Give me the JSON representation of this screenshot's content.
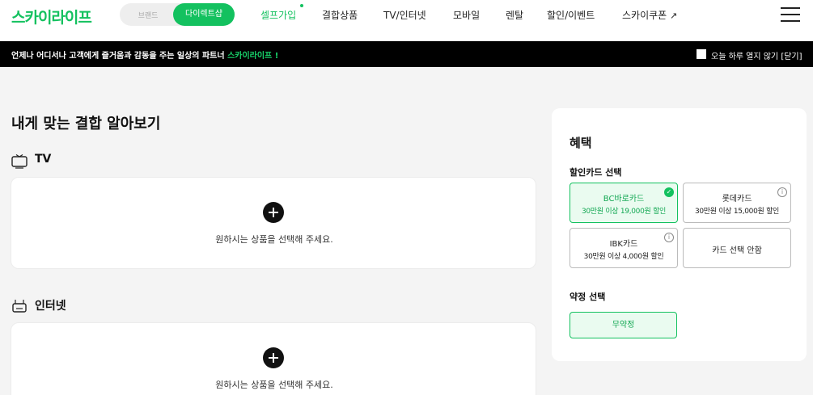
{
  "header": {
    "logo": "스카이라이프",
    "toggle": {
      "brand": "브랜드",
      "direct": "다이렉트샵"
    },
    "nav": [
      "셀프가입",
      "결합상품",
      "TV/인터넷",
      "모바일",
      "렌탈",
      "할인/이벤트",
      "스카이쿠폰"
    ],
    "nav_external_arrow": "↗",
    "menu_icon": "hamburger-menu-icon"
  },
  "notice": {
    "text": "언제나 어디서나 고객에게 즐거움과 감동을 주는 일상의 파트너 ",
    "highlight": "스카이라이프 !",
    "hide_today": "오늘 하루 열지 않기 [닫기]"
  },
  "main": {
    "title": "내게 맞는 결합 알아보기",
    "sections": [
      {
        "title": "TV",
        "icon": "tv-icon",
        "hint": "원하시는 상품을 선택해 주세요."
      },
      {
        "title": "인터넷",
        "icon": "router-icon",
        "hint": "원하시는 상품을 선택해 주세요."
      }
    ]
  },
  "benefit": {
    "title": "혜택",
    "card_section_title": "할인카드 선택",
    "cards": [
      {
        "name": "BC바로카드",
        "desc": "30만원 이상 19,000원 할인",
        "selected": true
      },
      {
        "name": "롯데카드",
        "desc": "30만원 이상 15,000원 할인",
        "selected": false
      },
      {
        "name": "IBK카드",
        "desc": "30만원 이상 4,000원 할인",
        "selected": false
      },
      {
        "name": "카드 선택 안함",
        "selected": false
      }
    ],
    "contract_section_title": "약정 선택",
    "contract_option": "무약정"
  },
  "colors": {
    "brand_green": "#13c15f",
    "notice_bg": "#000000",
    "page_bg": "#f4f4f4"
  }
}
